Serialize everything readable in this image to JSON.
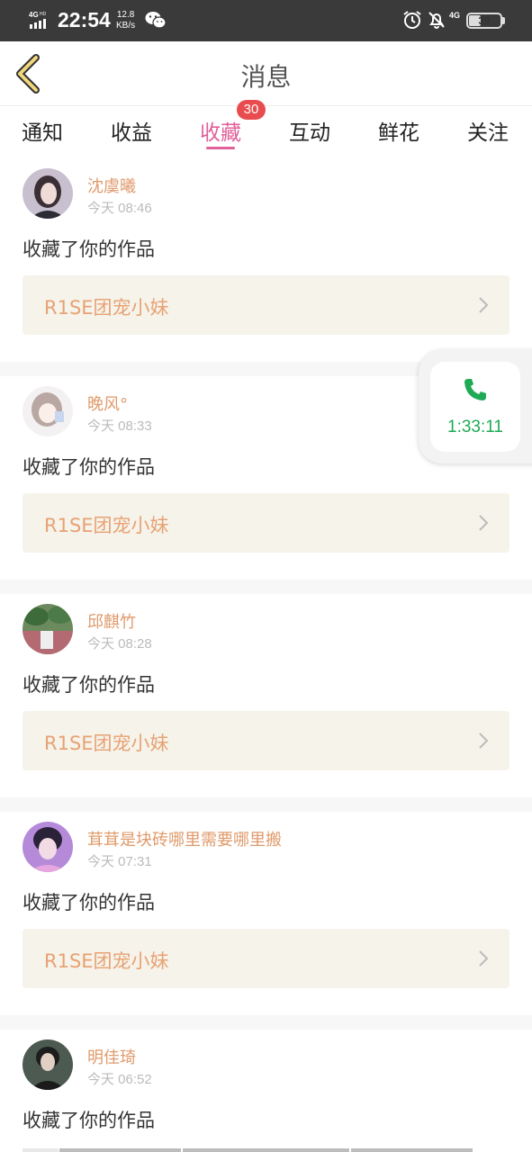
{
  "status_bar": {
    "network_top": "4G",
    "network_sup": "HD",
    "time": "22:54",
    "speed_value": "12.8",
    "speed_unit": "KB/s",
    "net_type": "4G",
    "battery": "39",
    "battery_level": 0.39
  },
  "header": {
    "title": "消息"
  },
  "tabs": [
    {
      "label": "通知"
    },
    {
      "label": "收益"
    },
    {
      "label": "收藏",
      "badge": "30",
      "active": true
    },
    {
      "label": "互动"
    },
    {
      "label": "鲜花"
    },
    {
      "label": "关注"
    }
  ],
  "cards": [
    {
      "username": "沈虞曦",
      "time": "今天 08:46",
      "action": "收藏了你的作品",
      "work": "R1SE团宠小妹"
    },
    {
      "username": "晚风°",
      "time": "今天 08:33",
      "action": "收藏了你的作品",
      "work": "R1SE团宠小妹"
    },
    {
      "username": "邱麒竹",
      "time": "今天 08:28",
      "action": "收藏了你的作品",
      "work": "R1SE团宠小妹"
    },
    {
      "username": "茸茸是块砖哪里需要哪里搬",
      "time": "今天 07:31",
      "action": "收藏了你的作品",
      "work": "R1SE团宠小妹"
    },
    {
      "username": "明佳琦",
      "time": "今天 06:52",
      "action": "收藏了你的作品",
      "work": ""
    }
  ],
  "call": {
    "timer": "1:33:11"
  },
  "colors": {
    "accent": "#e0609a",
    "username": "#e09a6b",
    "link_text": "#e8a274",
    "call": "#1faa55",
    "badge": "#e84c4f"
  }
}
